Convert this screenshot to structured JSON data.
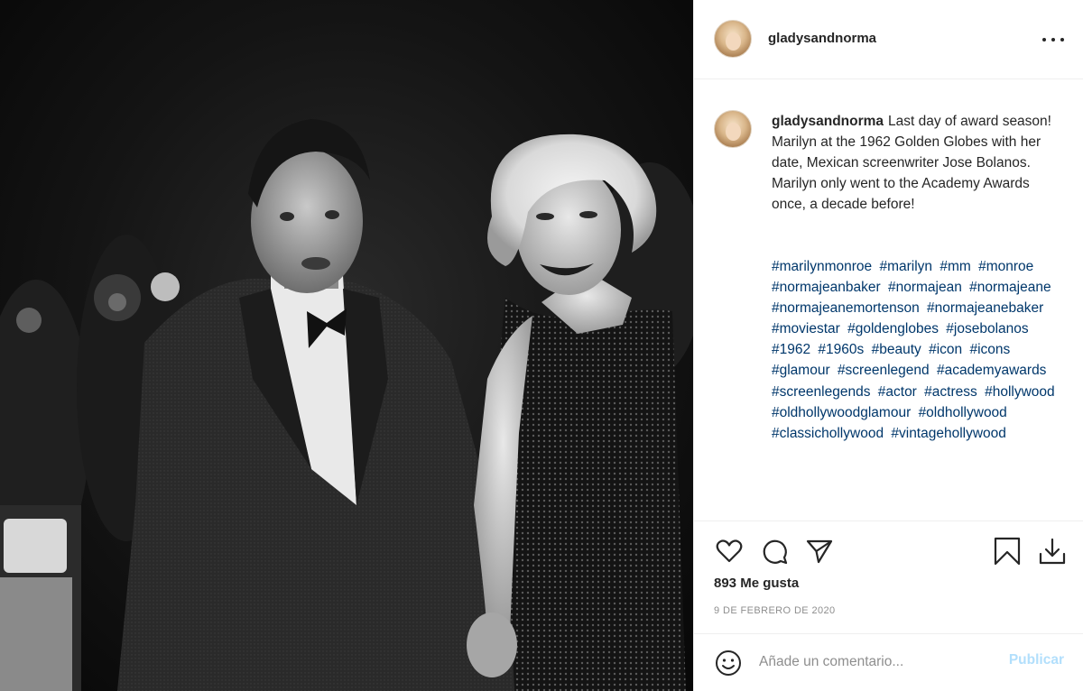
{
  "post": {
    "username": "gladysandnorma",
    "caption_text": "Last day of award season! Marilyn at the 1962 Golden Globes with her date, Mexican screenwriter Jose Bolanos. Marilyn only went to the Academy Awards once, a decade before!",
    "hashtags": [
      "#marilynmonroe",
      "#marilyn",
      "#mm",
      "#monroe",
      "#normajeanbaker",
      "#normajean",
      "#normajeane",
      "#normajeanemortenson",
      "#normajeanebaker",
      "#moviestar",
      "#goldenglobes",
      "#josebolanos",
      "#1962",
      "#1960s",
      "#beauty",
      "#icon",
      "#icons",
      "#glamour",
      "#screenlegend",
      "#academyawards",
      "#screenlegends",
      "#actor",
      "#actress",
      "#hollywood",
      "#oldhollywoodglamour",
      "#oldhollywood",
      "#classichollywood",
      "#vintagehollywood"
    ],
    "likes_text": "893 Me gusta",
    "date_text": "9 DE FEBRERO DE 2020"
  },
  "comment": {
    "placeholder": "Añade un comentario...",
    "publish_label": "Publicar"
  },
  "icons": {
    "more": "more-options-icon",
    "like": "heart-icon",
    "comment": "comment-icon",
    "share": "paper-plane-icon",
    "save": "bookmark-icon",
    "download": "download-icon",
    "emoji": "emoji-icon"
  },
  "colors": {
    "text": "#262626",
    "hashtag": "#00376b",
    "muted": "#8e8e8e",
    "publish_disabled": "#b2dffc",
    "border": "#efefef"
  }
}
